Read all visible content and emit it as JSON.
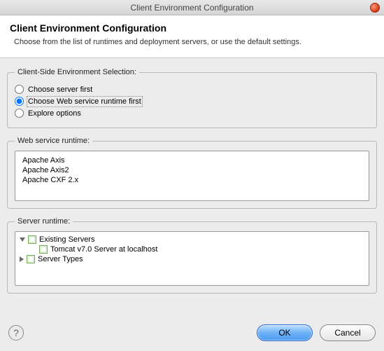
{
  "window": {
    "title": "Client Environment Configuration"
  },
  "header": {
    "title": "Client Environment Configuration",
    "subtitle": "Choose from the list of runtimes and deployment servers, or use the default settings."
  },
  "selection": {
    "legend": "Client-Side Environment Selection:",
    "options": [
      {
        "label": "Choose server first",
        "checked": false
      },
      {
        "label": "Choose Web service runtime first",
        "checked": true
      },
      {
        "label": "Explore options",
        "checked": false
      }
    ]
  },
  "runtime": {
    "legend": "Web service runtime:",
    "items": [
      "Apache Axis",
      "Apache Axis2",
      "Apache CXF 2.x"
    ]
  },
  "server": {
    "legend": "Server runtime:",
    "nodes": {
      "existing": "Existing Servers",
      "tomcat": "Tomcat v7.0 Server at localhost",
      "types": "Server Types"
    }
  },
  "footer": {
    "ok": "OK",
    "cancel": "Cancel",
    "help": "?"
  }
}
